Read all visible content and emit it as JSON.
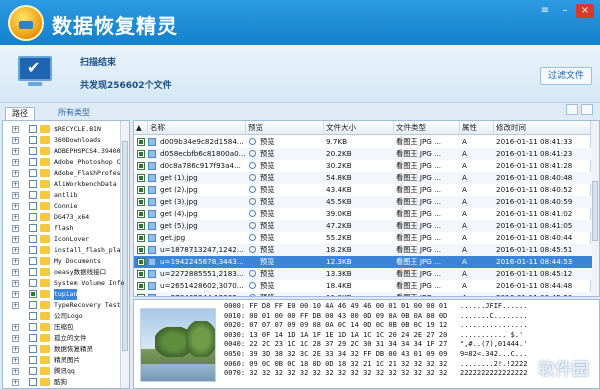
{
  "app": {
    "title": "数据恢复精灵"
  },
  "status": {
    "scan_state": "扫描结束",
    "found_text": "共发现256602个文件"
  },
  "toolbar": {
    "filter_label": "过滤文件"
  },
  "tabs": [
    "路径",
    "所有类型"
  ],
  "tree": [
    {
      "label": "$RECYCLE.BIN",
      "checked": false,
      "expand": "+"
    },
    {
      "label": "360Downloads",
      "checked": false,
      "expand": "+"
    },
    {
      "label": "ADBEPHSPCS4.39400",
      "checked": false,
      "expand": "+"
    },
    {
      "label": "Adobe Photoshop C",
      "checked": false,
      "expand": "+"
    },
    {
      "label": "Adobe_FlashProfes",
      "checked": false,
      "expand": "+"
    },
    {
      "label": "AliWorkbenchData",
      "checked": false,
      "expand": "+"
    },
    {
      "label": "antlib",
      "checked": false,
      "expand": "+"
    },
    {
      "label": "Connie",
      "checked": false,
      "expand": "+"
    },
    {
      "label": "DG473_x64",
      "checked": false,
      "expand": "+"
    },
    {
      "label": "flash",
      "checked": false,
      "expand": "+"
    },
    {
      "label": "IconLover",
      "checked": false,
      "expand": "+"
    },
    {
      "label": "install_flash_pla",
      "checked": false,
      "expand": "+"
    },
    {
      "label": "My Documents",
      "checked": false,
      "expand": "+"
    },
    {
      "label": "oeasy数据线接口",
      "checked": false,
      "expand": "+"
    },
    {
      "label": "System Volume Info",
      "checked": false,
      "expand": "+"
    },
    {
      "label": "tupian",
      "checked": true,
      "expand": "+",
      "selected": true
    },
    {
      "label": "TypeRecovery Test",
      "checked": false,
      "expand": "+"
    },
    {
      "label": "公司Logo",
      "checked": false,
      "expand": ""
    },
    {
      "label": "压缩包",
      "checked": false,
      "expand": "+"
    },
    {
      "label": "孤立的文件",
      "checked": false,
      "expand": "+"
    },
    {
      "label": "数据恢复精灵",
      "checked": false,
      "expand": "+"
    },
    {
      "label": "精灵图片",
      "checked": false,
      "expand": "+"
    },
    {
      "label": "腾讯qq",
      "checked": false,
      "expand": "+"
    },
    {
      "label": "酷狗",
      "checked": false,
      "expand": "+"
    }
  ],
  "table": {
    "columns": [
      "名称",
      "预览",
      "文件大小",
      "文件类型",
      "属性",
      "修改时间"
    ],
    "rows": [
      {
        "name": "d009b34e9c82d1584...",
        "preview": "预览",
        "size": "9.7KB",
        "type": "看图王 JPG ...",
        "attr": "A",
        "time": "2016-01-11 08:41:33"
      },
      {
        "name": "d058ecbfb6c81800a0...",
        "preview": "预览",
        "size": "20.2KB",
        "type": "看图王 JPG ...",
        "attr": "A",
        "time": "2016-01-11 08:41:23"
      },
      {
        "name": "d0c8a786c917f93a4...",
        "preview": "预览",
        "size": "30.2KB",
        "type": "看图王 JPG ...",
        "attr": "A",
        "time": "2016-01-11 08:41:28"
      },
      {
        "name": "get (1).jpg",
        "preview": "预览",
        "size": "54.8KB",
        "type": "看图王 JPG ...",
        "attr": "A",
        "time": "2016-01-11 08:40:48"
      },
      {
        "name": "get (2).jpg",
        "preview": "预览",
        "size": "43.4KB",
        "type": "看图王 JPG ...",
        "attr": "A",
        "time": "2016-01-11 08:40:52"
      },
      {
        "name": "get (3).jpg",
        "preview": "预览",
        "size": "45.5KB",
        "type": "看图王 JPG ...",
        "attr": "A",
        "time": "2016-01-11 08:40:59"
      },
      {
        "name": "get (4).jpg",
        "preview": "预览",
        "size": "39.0KB",
        "type": "看图王 JPG ...",
        "attr": "A",
        "time": "2016-01-11 08:41:02"
      },
      {
        "name": "get (5).jpg",
        "preview": "预览",
        "size": "47.2KB",
        "type": "看图王 JPG ...",
        "attr": "A",
        "time": "2016-01-11 08:41:05"
      },
      {
        "name": "get.jpg",
        "preview": "预览",
        "size": "55.2KB",
        "type": "看图王 JPG ...",
        "attr": "A",
        "time": "2016-01-11 08:40:44"
      },
      {
        "name": "u=1878713247,1242...",
        "preview": "预览",
        "size": "18.2KB",
        "type": "看图王 JPG ...",
        "attr": "A",
        "time": "2016-01-11 08:45:51"
      },
      {
        "name": "u=1942245678,3443...",
        "preview": "预览",
        "size": "12.3KB",
        "type": "看图王 JPG ...",
        "attr": "A",
        "time": "2016-01-11 08:44:53",
        "selected": true
      },
      {
        "name": "u=2272885551,2183...",
        "preview": "预览",
        "size": "13.3KB",
        "type": "看图王 JPG ...",
        "attr": "A",
        "time": "2016-01-11 08:45:12"
      },
      {
        "name": "u=2651428602,3070...",
        "preview": "预览",
        "size": "18.4KB",
        "type": "看图王 JPG ...",
        "attr": "A",
        "time": "2016-01-11 08:44:48"
      },
      {
        "name": "u=278465244,12382...",
        "preview": "预览",
        "size": "11.0KB",
        "type": "看图王 JPG ...",
        "attr": "A",
        "time": "2016-01-11 08:45:30"
      }
    ]
  },
  "hex": {
    "lines": [
      "0000: FF D8 FF E0 00 10 4A 46 49 46 00 01 01 00 00 01   ......JFIF......",
      "0010: 00 01 00 00 FF DB 00 43 00 0D 09 0A 0B 0A 08 0D   .......C........",
      "0020: 07 07 07 09 09 08 0A 0C 14 0D 0C 0B 0B 0C 19 12   ................",
      "0030: 13 0F 14 1D 1A 1F 1E 1D 1A 1C 1C 20 24 2E 27 20   ........... $.' ",
      "0040: 22 2C 23 1C 1C 28 37 29 2C 30 31 34 34 34 1F 27   \",#..(7),01444.'",
      "0050: 39 3D 38 32 3C 2E 33 34 32 FF DB 00 43 01 09 09   9=82<.342...C...",
      "0060: 09 0C 0B 0C 18 0D 0D 18 32 21 1C 21 32 32 32 32   ........2!.!2222",
      "0070: 32 32 32 32 32 32 32 32 32 32 32 32 32 32 32 32   2222222222222222"
    ]
  },
  "watermark": "软件园"
}
